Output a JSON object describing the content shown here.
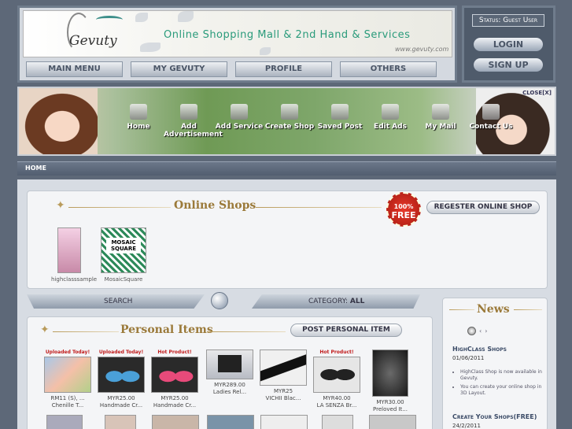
{
  "header": {
    "logo_text": "Gevuty",
    "tagline": "Online Shopping Mall  &  2nd Hand  &  Services",
    "url": "www.gevuty.com",
    "nav": [
      "MAIN MENU",
      "MY GEVUTY",
      "PROFILE",
      "OTHERS"
    ]
  },
  "account": {
    "status": "Status: Guest User",
    "login": "LOGIN",
    "signup": "SIGN UP"
  },
  "hero": {
    "close": "CLOSE[X]",
    "items": [
      "Home",
      "Add Advertisement",
      "Add Service",
      "Create Shop",
      "Saved Post",
      "Edit Ads",
      "My Mail",
      "Contact Us"
    ]
  },
  "breadcrumb": "HOME",
  "shops": {
    "title": "Online Shops",
    "badge_top": "100%",
    "badge_main": "FREE",
    "register": "REGESTER ONLINE SHOP",
    "list": [
      {
        "name": "highclasssample"
      },
      {
        "name": "MosaicSquare",
        "logo": "MOSAIC SQUARE"
      }
    ]
  },
  "search": {
    "label": "SEARCH",
    "category_label": "CATEGORY:",
    "category_value": "ALL"
  },
  "personal": {
    "title": "Personal Items",
    "post_button": "POST PERSONAL ITEM",
    "items": [
      {
        "badge": "Uploaded Today!",
        "price": "RM11 (S), ...",
        "name": "Chenille T..."
      },
      {
        "badge": "Uploaded Today!",
        "price": "MYR25.00",
        "name": "Handmade Cr..."
      },
      {
        "badge": "Hot Product!",
        "price": "MYR25.00",
        "name": "Handmade Cr..."
      },
      {
        "badge": "",
        "price": "MYR289.00",
        "name": "Ladies Rel..."
      },
      {
        "badge": "",
        "price": "MYR25",
        "name": "VICHII Blac..."
      },
      {
        "badge": "Hot Product!",
        "price": "MYR40.00",
        "name": "LA SENZA Br..."
      },
      {
        "badge": "",
        "price": "MYR30.00",
        "name": "Preloved It..."
      }
    ]
  },
  "news": {
    "title": "News",
    "entries": [
      {
        "heading": "HighClass Shops",
        "date": "01/06/2011",
        "bullets": [
          "HighClass Shop is now available in Gevuty.",
          "You can create your online shop in 3D Layout."
        ]
      },
      {
        "heading": "Create Your Shops(FREE)",
        "date": "24/2/2011",
        "bullets": []
      }
    ]
  },
  "colors": {
    "background": "#5d6878",
    "gold": "#9b7a3a",
    "teal": "#2a9b7b",
    "hot_red": "#c01a1a"
  }
}
